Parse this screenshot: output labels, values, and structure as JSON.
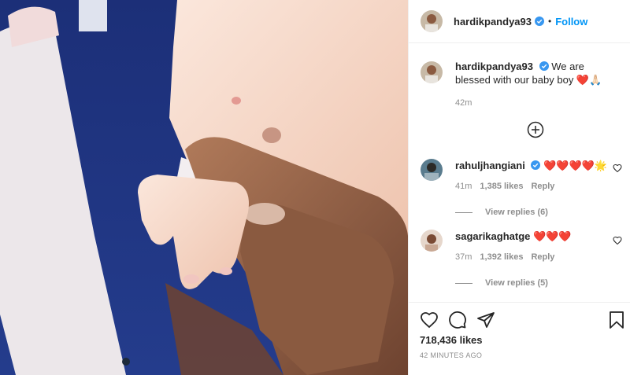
{
  "post": {
    "username": "hardikpandya93",
    "follow_label": "Follow",
    "separator": "•",
    "caption_text": "We are blessed with our baby boy ❤️🙏🏻",
    "caption_time": "42m",
    "likes": "718,436 likes",
    "time_ago": "42 MINUTES AGO"
  },
  "comments": [
    {
      "username": "rahuljhangiani",
      "text": "❤️❤️❤️❤️🌟",
      "time": "41m",
      "likes": "1,385 likes",
      "reply_label": "Reply",
      "view_replies": "View replies (6)"
    },
    {
      "username": "sagarikaghatge",
      "text": "❤️❤️❤️",
      "time": "37m",
      "likes": "1,392 likes",
      "reply_label": "Reply",
      "view_replies": "View replies (5)"
    }
  ],
  "colors": {
    "link": "#0095f6",
    "verified": "#3897f0",
    "muted": "#8e8e8e",
    "text": "#262626"
  },
  "icons": [
    "verified-icon",
    "add-more-icon",
    "heart-icon",
    "comment-icon",
    "share-icon",
    "bookmark-icon"
  ]
}
